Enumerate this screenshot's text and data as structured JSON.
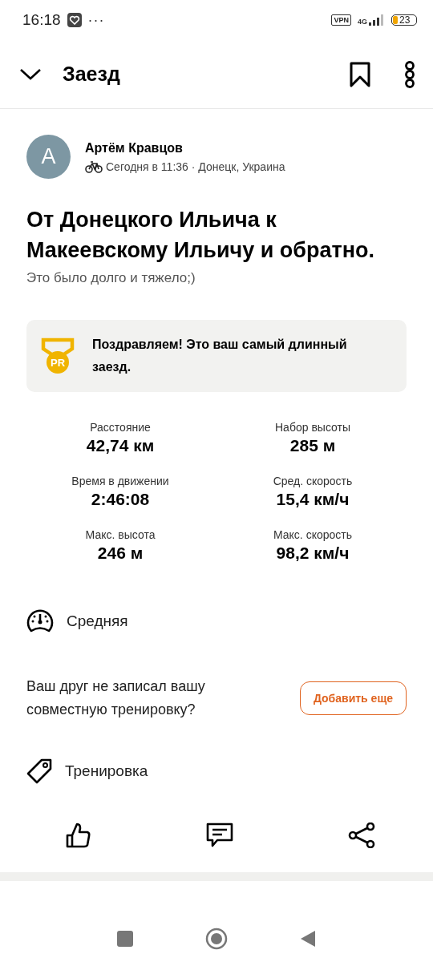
{
  "status_bar": {
    "time": "16:18",
    "more": "···",
    "vpn": "VPN",
    "network": "4G",
    "battery": "23"
  },
  "header": {
    "title": "Заезд"
  },
  "author": {
    "initial": "A",
    "name": "Артём Кравцов",
    "meta": "Сегодня в 11:36 · Донецк, Украина"
  },
  "activity": {
    "title": "От Донецкого Ильича к Макеевскому Ильичу и обратно.",
    "description": "Это было долго и тяжело;)"
  },
  "achievement": {
    "badge": "PR",
    "text": "Поздравляем! Это ваш самый длинный заезд."
  },
  "stats": [
    {
      "label": "Расстояние",
      "value": "42,74 км"
    },
    {
      "label": "Набор высоты",
      "value": "285 м"
    },
    {
      "label": "Время в движении",
      "value": "2:46:08"
    },
    {
      "label": "Сред. скорость",
      "value": "15,4 км/ч"
    },
    {
      "label": "Макс. высота",
      "value": "246 м"
    },
    {
      "label": "Макс. скорость",
      "value": "98,2 км/ч"
    }
  ],
  "effort": {
    "label": "Средняя"
  },
  "friend_prompt": {
    "text": "Ваш друг не записал вашу совместную тренировку?",
    "button": "Добавить еще"
  },
  "workout_type": {
    "label": "Тренировка"
  }
}
